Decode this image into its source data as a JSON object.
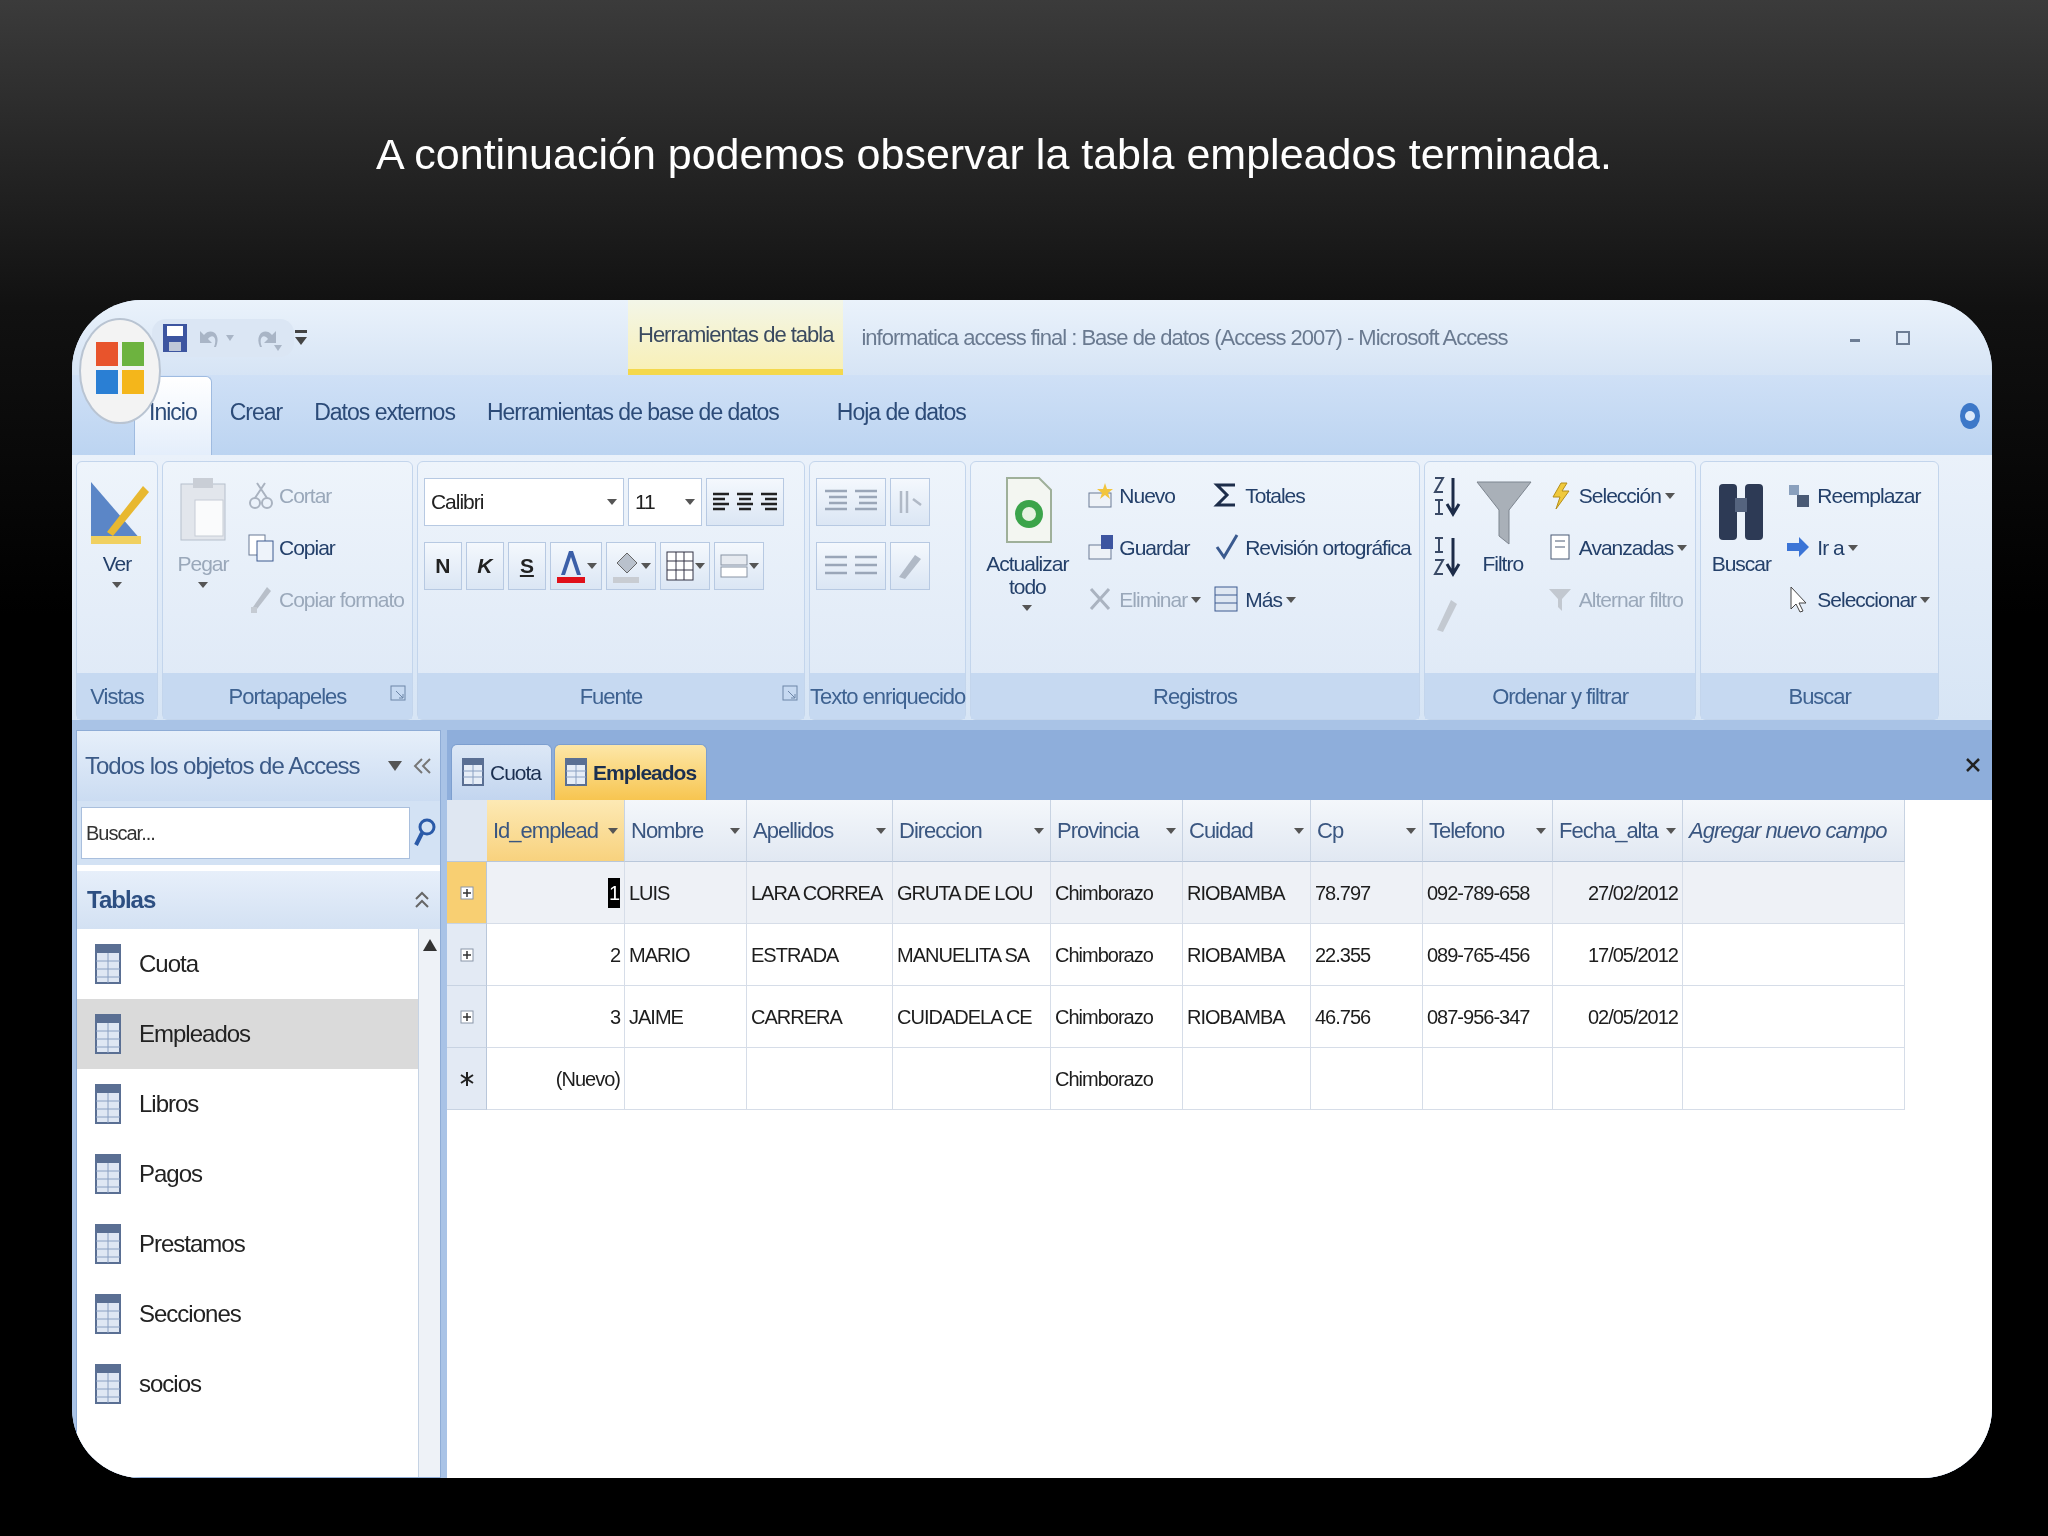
{
  "caption": "A continuación podemos observar la tabla empleados terminada.",
  "window": {
    "title": "informatica access final : Base de datos (Access 2007) - Microsoft Access",
    "context_tab": "Herramientas de tabla"
  },
  "ribbon_tabs": [
    {
      "label": "Inicio",
      "selected": true
    },
    {
      "label": "Crear",
      "selected": false
    },
    {
      "label": "Datos externos",
      "selected": false
    },
    {
      "label": "Herramientas de base de datos",
      "selected": false
    },
    {
      "label": "Hoja de datos",
      "selected": false
    }
  ],
  "ribbon_groups": [
    {
      "label": "Vistas",
      "launcher": false,
      "items": [
        {
          "kind": "large",
          "label": "Ver",
          "dropdown": true,
          "disabled": false
        }
      ]
    },
    {
      "label": "Portapapeles",
      "launcher": true,
      "items": [
        {
          "kind": "large",
          "label": "Pegar",
          "dropdown": true,
          "disabled": true
        },
        {
          "kind": "stack",
          "items": [
            {
              "label": "Cortar",
              "disabled": true,
              "dropdown": false
            },
            {
              "label": "Copiar",
              "disabled": false,
              "dropdown": false
            },
            {
              "label": "Copiar formato",
              "disabled": true,
              "dropdown": false
            }
          ]
        }
      ]
    },
    {
      "label": "Fuente",
      "launcher": true,
      "items": [
        {
          "kind": "font",
          "font": "Calibri",
          "size": "11",
          "styles": [
            "N",
            "K",
            "S"
          ]
        }
      ]
    },
    {
      "label": "Texto enriquecido",
      "launcher": false,
      "items": [
        {
          "kind": "paragraph_buttons"
        }
      ]
    },
    {
      "label": "Registros",
      "launcher": false,
      "items": [
        {
          "kind": "large",
          "label": "Actualizar todo",
          "dropdown": true,
          "disabled": false
        },
        {
          "kind": "stack",
          "items": [
            {
              "label": "Nuevo",
              "disabled": false,
              "dropdown": false
            },
            {
              "label": "Guardar",
              "disabled": false,
              "dropdown": false
            },
            {
              "label": "Eliminar",
              "disabled": true,
              "dropdown": true
            }
          ]
        },
        {
          "kind": "stack",
          "items": [
            {
              "label": "Totales",
              "disabled": false,
              "dropdown": false
            },
            {
              "label": "Revisión ortográfica",
              "disabled": false,
              "dropdown": false
            },
            {
              "label": "Más",
              "disabled": false,
              "dropdown": true
            }
          ]
        }
      ]
    },
    {
      "label": "Ordenar y filtrar",
      "launcher": false,
      "items": [
        {
          "kind": "sort_buttons"
        },
        {
          "kind": "large",
          "label": "Filtro",
          "dropdown": false,
          "disabled": false
        },
        {
          "kind": "stack",
          "items": [
            {
              "label": "Selección",
              "disabled": false,
              "dropdown": true
            },
            {
              "label": "Avanzadas",
              "disabled": false,
              "dropdown": true
            },
            {
              "label": "Alternar filtro",
              "disabled": true,
              "dropdown": false
            }
          ]
        }
      ]
    },
    {
      "label": "Buscar",
      "launcher": false,
      "items": [
        {
          "kind": "large",
          "label": "Buscar",
          "dropdown": false,
          "disabled": false
        },
        {
          "kind": "stack",
          "items": [
            {
              "label": "Reemplazar",
              "disabled": false,
              "dropdown": false
            },
            {
              "label": "Ir a",
              "disabled": false,
              "dropdown": true
            },
            {
              "label": "Seleccionar",
              "disabled": false,
              "dropdown": true
            }
          ]
        }
      ]
    }
  ],
  "nav_pane": {
    "title": "Todos los objetos de Access",
    "search": {
      "placeholder": "Buscar..."
    },
    "section": "Tablas",
    "items": [
      {
        "label": "Cuota",
        "selected": false
      },
      {
        "label": "Empleados",
        "selected": true
      },
      {
        "label": "Libros",
        "selected": false
      },
      {
        "label": "Pagos",
        "selected": false
      },
      {
        "label": "Prestamos",
        "selected": false
      },
      {
        "label": "Secciones",
        "selected": false
      },
      {
        "label": "socios",
        "selected": false
      }
    ]
  },
  "document_tabs": [
    {
      "label": "Cuota",
      "selected": false
    },
    {
      "label": "Empleados",
      "selected": true
    }
  ],
  "table": {
    "columns": [
      {
        "label": "Id_emplead",
        "filter": true,
        "selected": true
      },
      {
        "label": "Nombre",
        "filter": true,
        "selected": false
      },
      {
        "label": "Apellidos",
        "filter": true,
        "selected": false
      },
      {
        "label": "Direccion",
        "filter": true,
        "selected": false
      },
      {
        "label": "Provincia",
        "filter": true,
        "selected": false
      },
      {
        "label": "Cuidad",
        "filter": true,
        "selected": false
      },
      {
        "label": "Cp",
        "filter": true,
        "selected": false
      },
      {
        "label": "Telefono",
        "filter": true,
        "selected": false
      },
      {
        "label": "Fecha_alta",
        "filter": true,
        "selected": false
      },
      {
        "label": "Agregar nuevo campo",
        "filter": false,
        "selected": false
      }
    ],
    "rows": [
      {
        "kind": "record",
        "current": true,
        "cells": [
          "1",
          "LUIS",
          "LARA CORREA",
          "GRUTA DE LOU",
          "Chimborazo",
          "RIOBAMBA",
          "78.797",
          "092-789-658",
          "27/02/2012"
        ]
      },
      {
        "kind": "record",
        "current": false,
        "cells": [
          "2",
          "MARIO",
          "ESTRADA",
          "MANUELITA SA",
          "Chimborazo",
          "RIOBAMBA",
          "22.355",
          "089-765-456",
          "17/05/2012"
        ]
      },
      {
        "kind": "record",
        "current": false,
        "cells": [
          "3",
          "JAIME",
          "CARRERA",
          "CUIDADELA CE",
          "Chimborazo",
          "RIOBAMBA",
          "46.756",
          "087-956-347",
          "02/05/2012"
        ]
      },
      {
        "kind": "new",
        "current": false,
        "cells": [
          "(Nuevo)",
          "",
          "",
          "",
          "Chimborazo",
          "",
          "",
          "",
          ""
        ]
      }
    ]
  }
}
